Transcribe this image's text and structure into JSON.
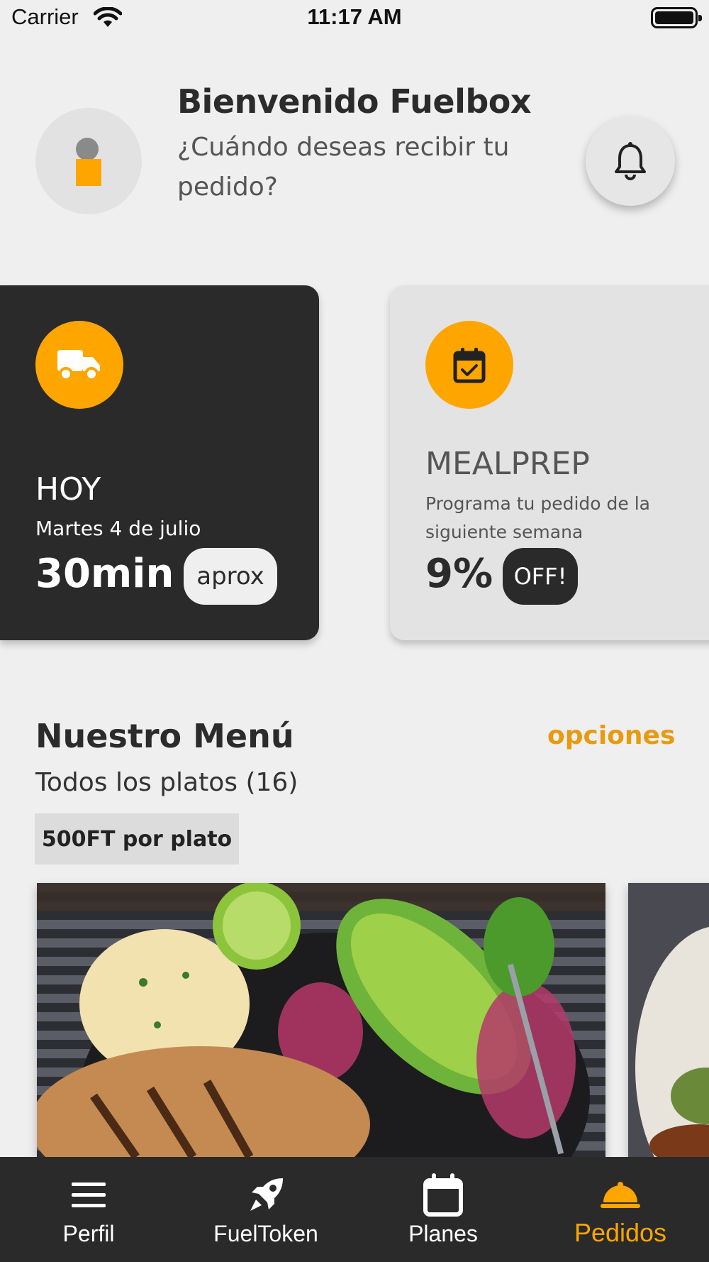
{
  "status_bar": {
    "carrier": "Carrier",
    "time": "11:17 AM"
  },
  "header": {
    "title": "Bienvenido Fuelbox",
    "subtitle": "¿Cuándo deseas recibir tu pedido?"
  },
  "cards": {
    "hoy": {
      "title": "HOY",
      "date": "Martes 4 de julio",
      "time": "30min",
      "pill": "aprox",
      "icon": "truck-icon"
    },
    "mealprep": {
      "title": "MEALPREP",
      "description": "Programa tu pedido de la siguiente semana",
      "discount": "9%",
      "pill": "OFF!",
      "icon": "calendar-check-icon"
    }
  },
  "menu": {
    "title": "Nuestro Menú",
    "options_link": "opciones",
    "subtitle": "Todos los platos (16)",
    "price_tag": "500FT por plato"
  },
  "tabs": [
    {
      "label": "Perfil",
      "icon": "menu-icon",
      "active": false
    },
    {
      "label": "FuelToken",
      "icon": "rocket-icon",
      "active": false
    },
    {
      "label": "Planes",
      "icon": "calendar-icon",
      "active": false
    },
    {
      "label": "Pedidos",
      "icon": "cloche-icon",
      "active": true
    }
  ],
  "colors": {
    "accent": "#ffa500",
    "dark": "#2a2a2a",
    "background": "#efefef",
    "link": "#e89a10"
  }
}
